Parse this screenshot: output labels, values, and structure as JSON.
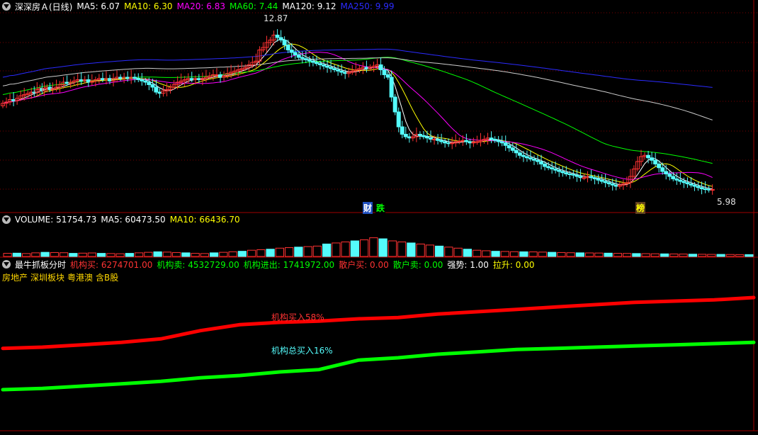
{
  "title": "深深房Ａ(日线)",
  "main_legend": [
    {
      "label": "MA5: 6.07",
      "color": "#ffffff"
    },
    {
      "label": "MA10: 6.30",
      "color": "#ffff00"
    },
    {
      "label": "MA20: 6.83",
      "color": "#ff00ff"
    },
    {
      "label": "MA60: 7.44",
      "color": "#00ff00"
    },
    {
      "label": "MA120: 9.12",
      "color": "#ffffff"
    },
    {
      "label": "MA250: 9.99",
      "color": "#2b2bff"
    }
  ],
  "volume_legend": [
    {
      "label": "VOLUME: 51754.73",
      "color": "#ffffff"
    },
    {
      "label": "MA5: 60473.50",
      "color": "#ffffff"
    },
    {
      "label": "MA10: 66436.70",
      "color": "#ffff00"
    }
  ],
  "indicator_name": "最牛抓板分时",
  "indicator_legend": [
    {
      "label": "机构买: 6274701.00",
      "color": "#ff3333"
    },
    {
      "label": "机构卖: 4532729.00",
      "color": "#00ff00"
    },
    {
      "label": "机构进出: 1741972.00",
      "color": "#00ff00"
    },
    {
      "label": "散户买: 0.00",
      "color": "#ff3333"
    },
    {
      "label": "散户卖: 0.00",
      "color": "#00ff00"
    },
    {
      "label": "强势: 1.00",
      "color": "#ffffff"
    },
    {
      "label": "拉升: 0.00",
      "color": "#ffff00"
    }
  ],
  "sectors": [
    "房地产",
    "深圳板块",
    "粤港澳",
    "含B股"
  ],
  "annotations": {
    "high_label": "12.87",
    "low_label": "5.98",
    "buy_pct_label": "机构买入58%",
    "total_buy_label": "机构总买入16%"
  },
  "markers": [
    {
      "label": "财",
      "color": "#ffffff",
      "bg": "#2050c0"
    },
    {
      "label": "跌",
      "color": "#00ff00",
      "bg": "#000000"
    },
    {
      "label": "榜",
      "color": "#ffff00",
      "bg": "#604020"
    }
  ],
  "colors": {
    "up": "#ff3232",
    "down": "#54fcfc",
    "grid": "#7a0000",
    "separator": "#a00000",
    "red_line": "#ff0000",
    "green_line": "#00ff00"
  },
  "chart_data": [
    {
      "type": "candlestick",
      "price_range": [
        5.6,
        13.2
      ],
      "high": 12.87,
      "low": 5.98,
      "x": [
        0,
        5,
        10,
        15,
        20,
        25,
        30,
        35,
        40,
        44,
        48,
        52,
        55,
        58,
        62,
        66,
        70,
        75,
        80,
        85,
        90,
        95,
        100,
        105,
        110,
        115,
        120,
        125,
        130,
        135,
        140,
        145,
        150,
        155,
        160,
        165,
        170,
        175,
        180,
        185,
        190,
        195,
        200,
        205,
        210,
        215,
        220,
        225,
        230,
        235,
        240,
        245,
        250,
        255,
        260,
        265,
        270,
        275,
        280,
        285,
        290,
        295,
        300,
        305,
        310,
        315,
        320,
        325,
        330,
        335,
        340,
        345,
        350,
        355,
        360,
        365,
        370,
        375,
        380,
        385,
        390,
        395,
        400,
        405,
        410,
        415,
        420,
        425,
        430,
        435,
        440,
        445,
        450,
        455,
        460,
        465,
        470,
        475,
        480,
        485,
        490,
        495,
        500,
        505,
        510,
        515,
        520,
        525,
        530,
        535,
        540,
        545,
        550,
        555,
        560,
        565,
        570,
        575,
        580,
        585,
        590,
        595,
        600,
        605,
        610,
        615,
        620,
        625,
        630,
        635,
        640,
        645,
        650,
        655,
        660,
        665,
        670,
        675,
        680,
        685,
        690,
        695,
        700,
        705,
        710,
        715,
        720,
        725,
        730,
        735,
        740,
        745,
        750,
        755,
        760,
        765,
        770,
        775,
        780,
        785,
        790,
        795,
        800,
        805,
        810,
        815,
        820,
        825,
        830,
        835,
        840,
        845,
        850,
        855,
        860,
        865,
        870,
        875,
        880,
        885,
        890,
        895,
        900,
        905,
        910,
        915,
        920,
        925,
        930,
        935,
        940,
        945,
        950,
        955,
        960,
        965,
        970,
        975,
        980,
        985,
        990,
        995,
        1000,
        1005,
        1010,
        1015,
        1020,
        1025,
        1030,
        1035,
        1040,
        1045
      ],
      "close": [
        9.55,
        9.6,
        9.7,
        9.65,
        9.75,
        9.85,
        9.9,
        9.95,
        10.0,
        9.98,
        10.1,
        10.15,
        10.05,
        10.15,
        10.2,
        10.1,
        10.15,
        10.2,
        10.3,
        10.4,
        10.35,
        10.4,
        10.45,
        10.5,
        10.45,
        10.5,
        10.4,
        10.45,
        10.5,
        10.55,
        10.5,
        10.55,
        10.45,
        10.55,
        10.6,
        10.55,
        10.6,
        10.55,
        10.6,
        10.55,
        10.5,
        10.45,
        10.4,
        10.3,
        10.2,
        10.0,
        9.95,
        10.05,
        10.1,
        10.2,
        10.3,
        10.4,
        10.45,
        10.5,
        10.55,
        10.5,
        10.55,
        10.5,
        10.55,
        10.6,
        10.65,
        10.7,
        10.7,
        10.6,
        10.65,
        10.75,
        10.8,
        10.85,
        10.9,
        10.95,
        11.0,
        11.1,
        11.2,
        11.25,
        11.7,
        11.8,
        12.0,
        12.1,
        12.3,
        12.2,
        12.1,
        11.9,
        11.7,
        11.6,
        11.5,
        11.4,
        11.35,
        11.3,
        11.25,
        11.2,
        11.15,
        11.1,
        11.05,
        11.0,
        10.95,
        10.9,
        10.85,
        10.8,
        10.75,
        10.8,
        10.85,
        10.9,
        10.95,
        11.0,
        10.95,
        11.0,
        11.05,
        11.1,
        10.9,
        10.7,
        10.6,
        9.8,
        9.2,
        8.6,
        8.3,
        8.2,
        8.15,
        8.2,
        8.3,
        8.25,
        8.2,
        8.15,
        8.1,
        8.1,
        8.05,
        8.0,
        7.95,
        7.92,
        7.95,
        8.0,
        8.02,
        8.05,
        8.0,
        7.95,
        7.98,
        8.0,
        8.05,
        8.1,
        8.15,
        8.1,
        8.05,
        8.0,
        7.95,
        7.85,
        7.75,
        7.65,
        7.55,
        7.45,
        7.4,
        7.35,
        7.3,
        7.25,
        7.2,
        7.1,
        7.0,
        6.95,
        6.9,
        6.85,
        6.8,
        6.75,
        6.7,
        6.68,
        6.65,
        6.6,
        6.55,
        6.55,
        6.6,
        6.55,
        6.5,
        6.45,
        6.4,
        6.35,
        6.3,
        6.25,
        6.2,
        6.25,
        6.3,
        6.35,
        6.6,
        6.9,
        7.2,
        7.4,
        7.45,
        7.35,
        7.25,
        7.1,
        6.95,
        6.8,
        6.7,
        6.6,
        6.5,
        6.45,
        6.4,
        6.35,
        6.3,
        6.25,
        6.2,
        6.15,
        6.1,
        6.08,
        6.05,
        6.07
      ],
      "ma5": [
        9.55,
        9.6,
        9.7,
        9.65,
        9.75,
        9.85,
        9.9,
        9.95,
        10.0,
        9.98,
        10.1,
        10.15,
        10.05,
        10.15,
        10.2,
        10.1,
        10.15,
        10.2,
        10.3,
        10.4,
        10.35,
        10.4,
        10.45,
        10.5,
        10.45,
        10.5,
        10.4,
        10.45,
        10.5,
        10.55,
        10.5,
        10.55,
        10.45,
        10.55,
        10.6,
        10.55,
        10.6,
        10.55,
        10.6,
        10.55,
        10.5,
        10.45,
        10.4,
        10.3,
        10.2,
        10.0,
        9.95,
        10.05,
        10.1,
        10.2,
        10.3,
        10.4,
        10.45,
        10.5,
        10.55,
        10.5,
        10.55,
        10.5,
        10.55,
        10.6,
        10.65,
        10.7,
        10.7,
        10.6,
        10.65,
        10.75,
        10.8,
        10.85,
        10.9,
        10.95,
        11.0,
        11.1,
        11.2,
        11.25,
        11.7,
        11.8,
        12.0,
        12.1,
        12.3,
        12.2,
        12.1,
        11.9,
        11.7,
        11.6,
        11.5,
        11.4,
        11.35,
        11.3,
        11.25,
        11.2,
        11.15,
        11.1,
        11.05,
        11.0,
        10.95,
        10.9,
        10.85,
        10.8,
        10.75,
        10.8,
        10.85,
        10.9,
        10.95,
        11.0,
        10.95,
        11.0,
        11.05,
        11.1,
        10.9,
        10.7,
        10.6,
        9.8,
        9.2,
        8.6,
        8.3,
        8.2,
        8.15,
        8.2,
        8.3,
        8.25,
        8.2,
        8.15,
        8.1,
        8.1,
        8.05,
        8.0,
        7.95,
        7.92,
        7.95,
        8.0,
        8.02,
        8.05,
        8.0,
        7.95,
        7.98,
        8.0,
        8.05,
        8.1,
        8.15,
        8.1,
        8.05,
        8.0,
        7.95,
        7.85,
        7.75,
        7.65,
        7.55,
        7.45,
        7.4,
        7.35,
        7.3,
        7.25,
        7.2,
        7.1,
        7.0,
        6.95,
        6.9,
        6.85,
        6.8,
        6.75,
        6.7,
        6.68,
        6.65,
        6.6,
        6.55,
        6.55,
        6.6,
        6.55,
        6.5,
        6.45,
        6.4,
        6.35,
        6.3,
        6.25,
        6.2,
        6.25,
        6.3,
        6.35,
        6.6,
        6.9,
        7.2,
        7.4,
        7.45,
        7.35,
        7.25,
        7.1,
        6.95,
        6.8,
        6.7,
        6.6,
        6.5,
        6.45,
        6.4,
        6.35,
        6.3,
        6.25,
        6.2,
        6.15,
        6.1,
        6.08,
        6.05,
        6.07
      ]
    },
    {
      "type": "bar",
      "title": "VOLUME",
      "values": [
        30,
        32,
        28,
        35,
        40,
        38,
        36,
        30,
        32,
        34,
        30,
        28,
        26,
        30,
        35,
        40,
        45,
        42,
        38,
        35,
        30,
        28,
        35,
        40,
        45,
        50,
        60,
        65,
        70,
        80,
        85,
        90,
        95,
        100,
        120,
        130,
        140,
        150,
        160,
        180,
        170,
        150,
        140,
        130,
        120,
        110,
        100,
        90,
        80,
        70,
        60,
        55,
        50,
        48,
        46,
        45,
        44,
        42,
        40,
        38,
        36,
        35,
        34,
        33,
        32,
        30,
        29,
        28,
        27,
        26,
        25,
        24,
        23,
        22,
        21,
        20,
        20,
        19,
        18,
        18
      ],
      "ylim": [
        0,
        300
      ]
    },
    {
      "type": "line",
      "series": [
        {
          "name": "机构买",
          "values": [
            6.5,
            6.6,
            6.8,
            7.0,
            7.3,
            8.0,
            8.5,
            8.7,
            8.8,
            9.0,
            9.1,
            9.4,
            9.6,
            9.8,
            10.0,
            10.2,
            10.4,
            10.5,
            10.6,
            10.8
          ]
        },
        {
          "name": "机构卖",
          "values": [
            3.0,
            3.1,
            3.3,
            3.5,
            3.7,
            4.0,
            4.2,
            4.5,
            4.7,
            5.5,
            5.7,
            6.0,
            6.2,
            6.4,
            6.5,
            6.6,
            6.7,
            6.8,
            6.9,
            7.0
          ]
        }
      ],
      "ylim": [
        0,
        12
      ]
    }
  ]
}
